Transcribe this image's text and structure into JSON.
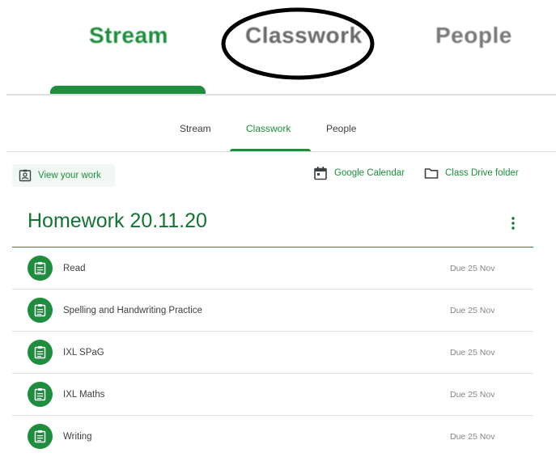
{
  "zoom_tabs": {
    "stream": "Stream",
    "classwork": "Classwork",
    "people": "People"
  },
  "tabs": {
    "stream": "Stream",
    "classwork": "Classwork",
    "people": "People",
    "active": "Classwork"
  },
  "toolbar": {
    "view_work": "View your work",
    "calendar": "Google Calendar",
    "drive": "Class Drive folder"
  },
  "topic": {
    "title": "Homework 20.11.20",
    "assignments": [
      {
        "title": "Read",
        "due": "Due 25 Nov"
      },
      {
        "title": "Spelling and Handwriting Practice",
        "due": "Due 25 Nov"
      },
      {
        "title": "IXL SPaG",
        "due": "Due 25 Nov"
      },
      {
        "title": "IXL Maths",
        "due": "Due 25 Nov"
      },
      {
        "title": "Writing",
        "due": "Due 25 Nov"
      }
    ]
  },
  "colors": {
    "accent": "#1e8e3e",
    "title_green": "#137333",
    "annotation": "#000000"
  },
  "icons": {
    "view_work": "assignment-person-icon",
    "calendar": "calendar-icon",
    "drive": "folder-icon",
    "more": "more-vert-icon",
    "assignment": "assignment-icon"
  }
}
